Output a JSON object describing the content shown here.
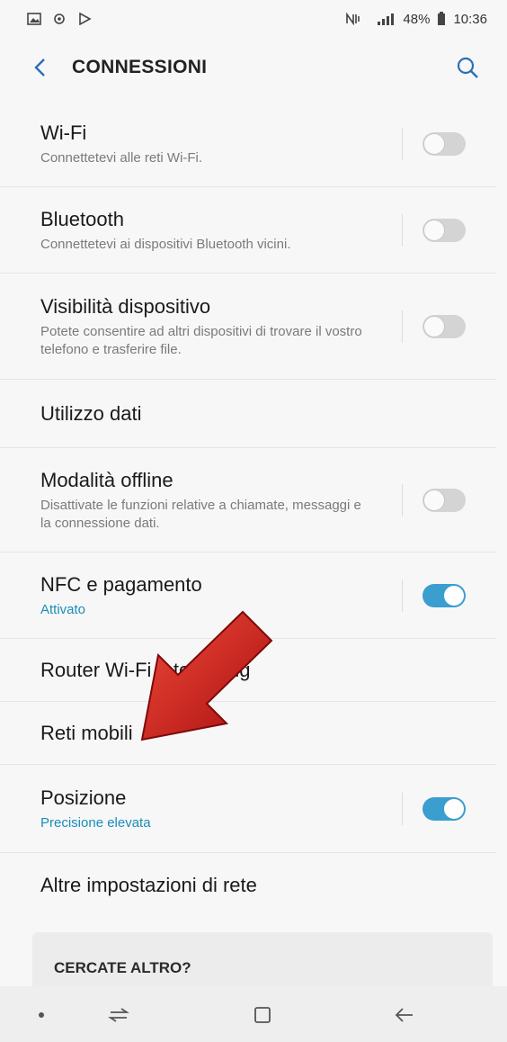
{
  "status_bar": {
    "battery": "48%",
    "time": "10:36"
  },
  "header": {
    "title": "CONNESSIONI"
  },
  "settings": [
    {
      "title": "Wi-Fi",
      "subtitle": "Connettetevi alle reti Wi-Fi.",
      "toggle": false
    },
    {
      "title": "Bluetooth",
      "subtitle": "Connettetevi ai dispositivi Bluetooth vicini.",
      "toggle": false
    },
    {
      "title": "Visibilità dispositivo",
      "subtitle": "Potete consentire ad altri dispositivi di trovare il vostro telefono e trasferire file.",
      "toggle": false
    },
    {
      "title": "Utilizzo dati"
    },
    {
      "title": "Modalità offline",
      "subtitle": "Disattivate le funzioni relative a chiamate, messaggi e la connessione dati.",
      "toggle": false
    },
    {
      "title": "NFC e pagamento",
      "subtitle": "Attivato",
      "toggle": true
    },
    {
      "title": "Router Wi-Fi e tethering"
    },
    {
      "title": "Reti mobili"
    },
    {
      "title": "Posizione",
      "subtitle": "Precisione elevata",
      "toggle": true
    },
    {
      "title": "Altre impostazioni di rete"
    }
  ],
  "search_card": {
    "label": "CERCATE ALTRO?"
  },
  "colors": {
    "accent": "#3a9ecf",
    "active_text": "#1a8db8",
    "arrow": "#d41f1f"
  },
  "icons": {
    "back": "chevron-left-icon",
    "search": "search-icon",
    "nav_recent": "recent-apps-icon",
    "nav_home": "home-icon",
    "nav_back": "back-arrow-icon"
  }
}
